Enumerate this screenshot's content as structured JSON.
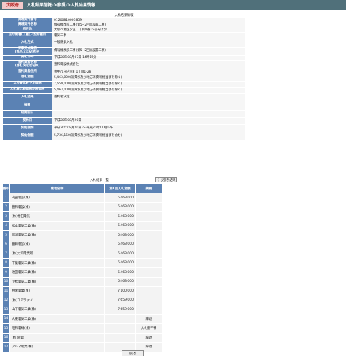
{
  "header": {
    "badge": "大阪府",
    "breadcrumb": "入札結果情報->参照->入札結果情報"
  },
  "detail": {
    "title": "入札結果情報",
    "rows": [
      {
        "key": "調達案件番号",
        "value": "01200810003859"
      },
      {
        "key": "調達案件名称",
        "value": "償号機改良工事(第5−2回)(設置工事)"
      },
      {
        "key": "所在地",
        "value": "大阪市港区夕凪二丁目9番15号先ほか"
      },
      {
        "key": "主な業種(工種)／契約種目",
        "value": "電気工事"
      },
      {
        "key": "入札方式",
        "value": "一般競争入札"
      },
      {
        "key": "工事又は業務\n(物品又は役務)名",
        "value": "償号機改良工事(第5−2回)(設置工事)"
      },
      {
        "key": "開札日時",
        "value": "平成20年08月07日 14時15分"
      },
      {
        "key": "落札業者名称\n(落札決定者名称)",
        "value": "豊和電設株式会社"
      },
      {
        "key": "落札業者住所",
        "value": "豊中市庄内幸町1丁目1-28"
      },
      {
        "key": "落札金額",
        "value": "5,463,000(消費税及び地方消費税相当額を除く)"
      },
      {
        "key": "入札書比較予定価格",
        "value": "7,659,000(消費税及び地方消費税相当額を除く)"
      },
      {
        "key": "入札書比較価格制限価格",
        "value": "5,463,000(消費税及び地方消費税相当額を除く)"
      },
      {
        "key": "入札結果",
        "value": "落札者決定"
      },
      {
        "key": "摘要",
        "value": ""
      },
      {
        "key": "延期前日",
        "value": ""
      },
      {
        "key": "契約日",
        "value": "平成20年08月20日"
      },
      {
        "key": "契約期間",
        "value": "平成20年08月20日 〜 平成20年11月17日"
      },
      {
        "key": "契約金額",
        "value": "5,736,150(消費税及び地方消費税相当額を含む)"
      }
    ]
  },
  "results": {
    "title": "入札結果一覧",
    "lottery_button": "くじ引き結果",
    "headers": {
      "no": "番号",
      "bidder": "業者名称",
      "amount": "第1回入札金額",
      "remarks": "摘要"
    },
    "rows": [
      {
        "no": "1",
        "bidder": "内田電設(株)",
        "amount": "5,463,000",
        "remarks": ""
      },
      {
        "no": "2",
        "bidder": "豊和電設(株)",
        "amount": "5,463,000",
        "remarks": ""
      },
      {
        "no": "3",
        "bidder": "(株)村田電気",
        "amount": "5,463,000",
        "remarks": ""
      },
      {
        "no": "4",
        "bidder": "松本電気工業(株)",
        "amount": "5,463,000",
        "remarks": ""
      },
      {
        "no": "5",
        "bidder": "三浦電気工業(株)",
        "amount": "5,463,000",
        "remarks": ""
      },
      {
        "no": "6",
        "bidder": "豊和電設(株)",
        "amount": "5,463,000",
        "remarks": ""
      },
      {
        "no": "7",
        "bidder": "(株)大和電業所",
        "amount": "5,463,000",
        "remarks": ""
      },
      {
        "no": "8",
        "bidder": "千葉電気工業(株)",
        "amount": "5,463,000",
        "remarks": ""
      },
      {
        "no": "9",
        "bidder": "池田電気工業(株)",
        "amount": "5,463,000",
        "remarks": ""
      },
      {
        "no": "10",
        "bidder": "小松電気工業(株)",
        "amount": "5,463,000",
        "remarks": ""
      },
      {
        "no": "11",
        "bidder": "共栄電業(株)",
        "amount": "7,100,000",
        "remarks": ""
      },
      {
        "no": "12",
        "bidder": "(株)コアテクノ",
        "amount": "7,659,000",
        "remarks": ""
      },
      {
        "no": "13",
        "bidder": "山下電気工業(株)",
        "amount": "7,659,000",
        "remarks": ""
      },
      {
        "no": "14",
        "bidder": "大東電気工業(株)",
        "amount": "",
        "remarks": "辞退"
      },
      {
        "no": "15",
        "bidder": "昭和電線(株)",
        "amount": "",
        "remarks": "入札書不備"
      },
      {
        "no": "16",
        "bidder": "(株)創電",
        "amount": "",
        "remarks": "辞退"
      },
      {
        "no": "17",
        "bidder": "アルマ電業(株)",
        "amount": "",
        "remarks": "辞退"
      }
    ]
  },
  "footer": {
    "back_button": "戻る"
  }
}
